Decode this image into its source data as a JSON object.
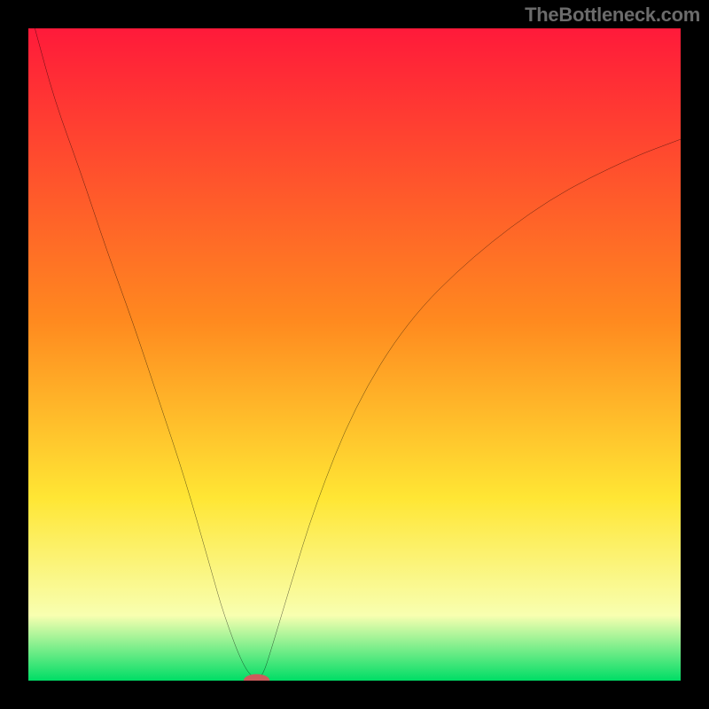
{
  "attribution": "TheBottleneck.com",
  "chart_data": {
    "type": "line",
    "title": "",
    "xlabel": "",
    "ylabel": "",
    "xlim": [
      0,
      100
    ],
    "ylim": [
      0,
      100
    ],
    "legend": false,
    "gradient_bg": {
      "top": "#ff1a3a",
      "mid1": "#ff8a1f",
      "mid2": "#ffe634",
      "mid3": "#f8ffb0",
      "bottom": "#00dd66"
    },
    "series": [
      {
        "name": "V-curve",
        "stroke": "#000000",
        "x": [
          1,
          4,
          8,
          12,
          16,
          20,
          24,
          28,
          30,
          33,
          35,
          36,
          37,
          40,
          44,
          50,
          58,
          68,
          80,
          92,
          100
        ],
        "y": [
          100,
          89,
          78,
          66,
          55,
          43,
          31,
          17,
          10,
          2,
          0,
          1,
          4,
          14,
          27,
          42,
          55,
          65,
          74,
          80,
          83
        ]
      }
    ],
    "marker": {
      "name": "optimal-marker",
      "shape": "rounded-rect",
      "fill": "#cd5c5c",
      "cx": 35,
      "cy": 0,
      "rx": 2.0,
      "ry": 1.0
    }
  }
}
